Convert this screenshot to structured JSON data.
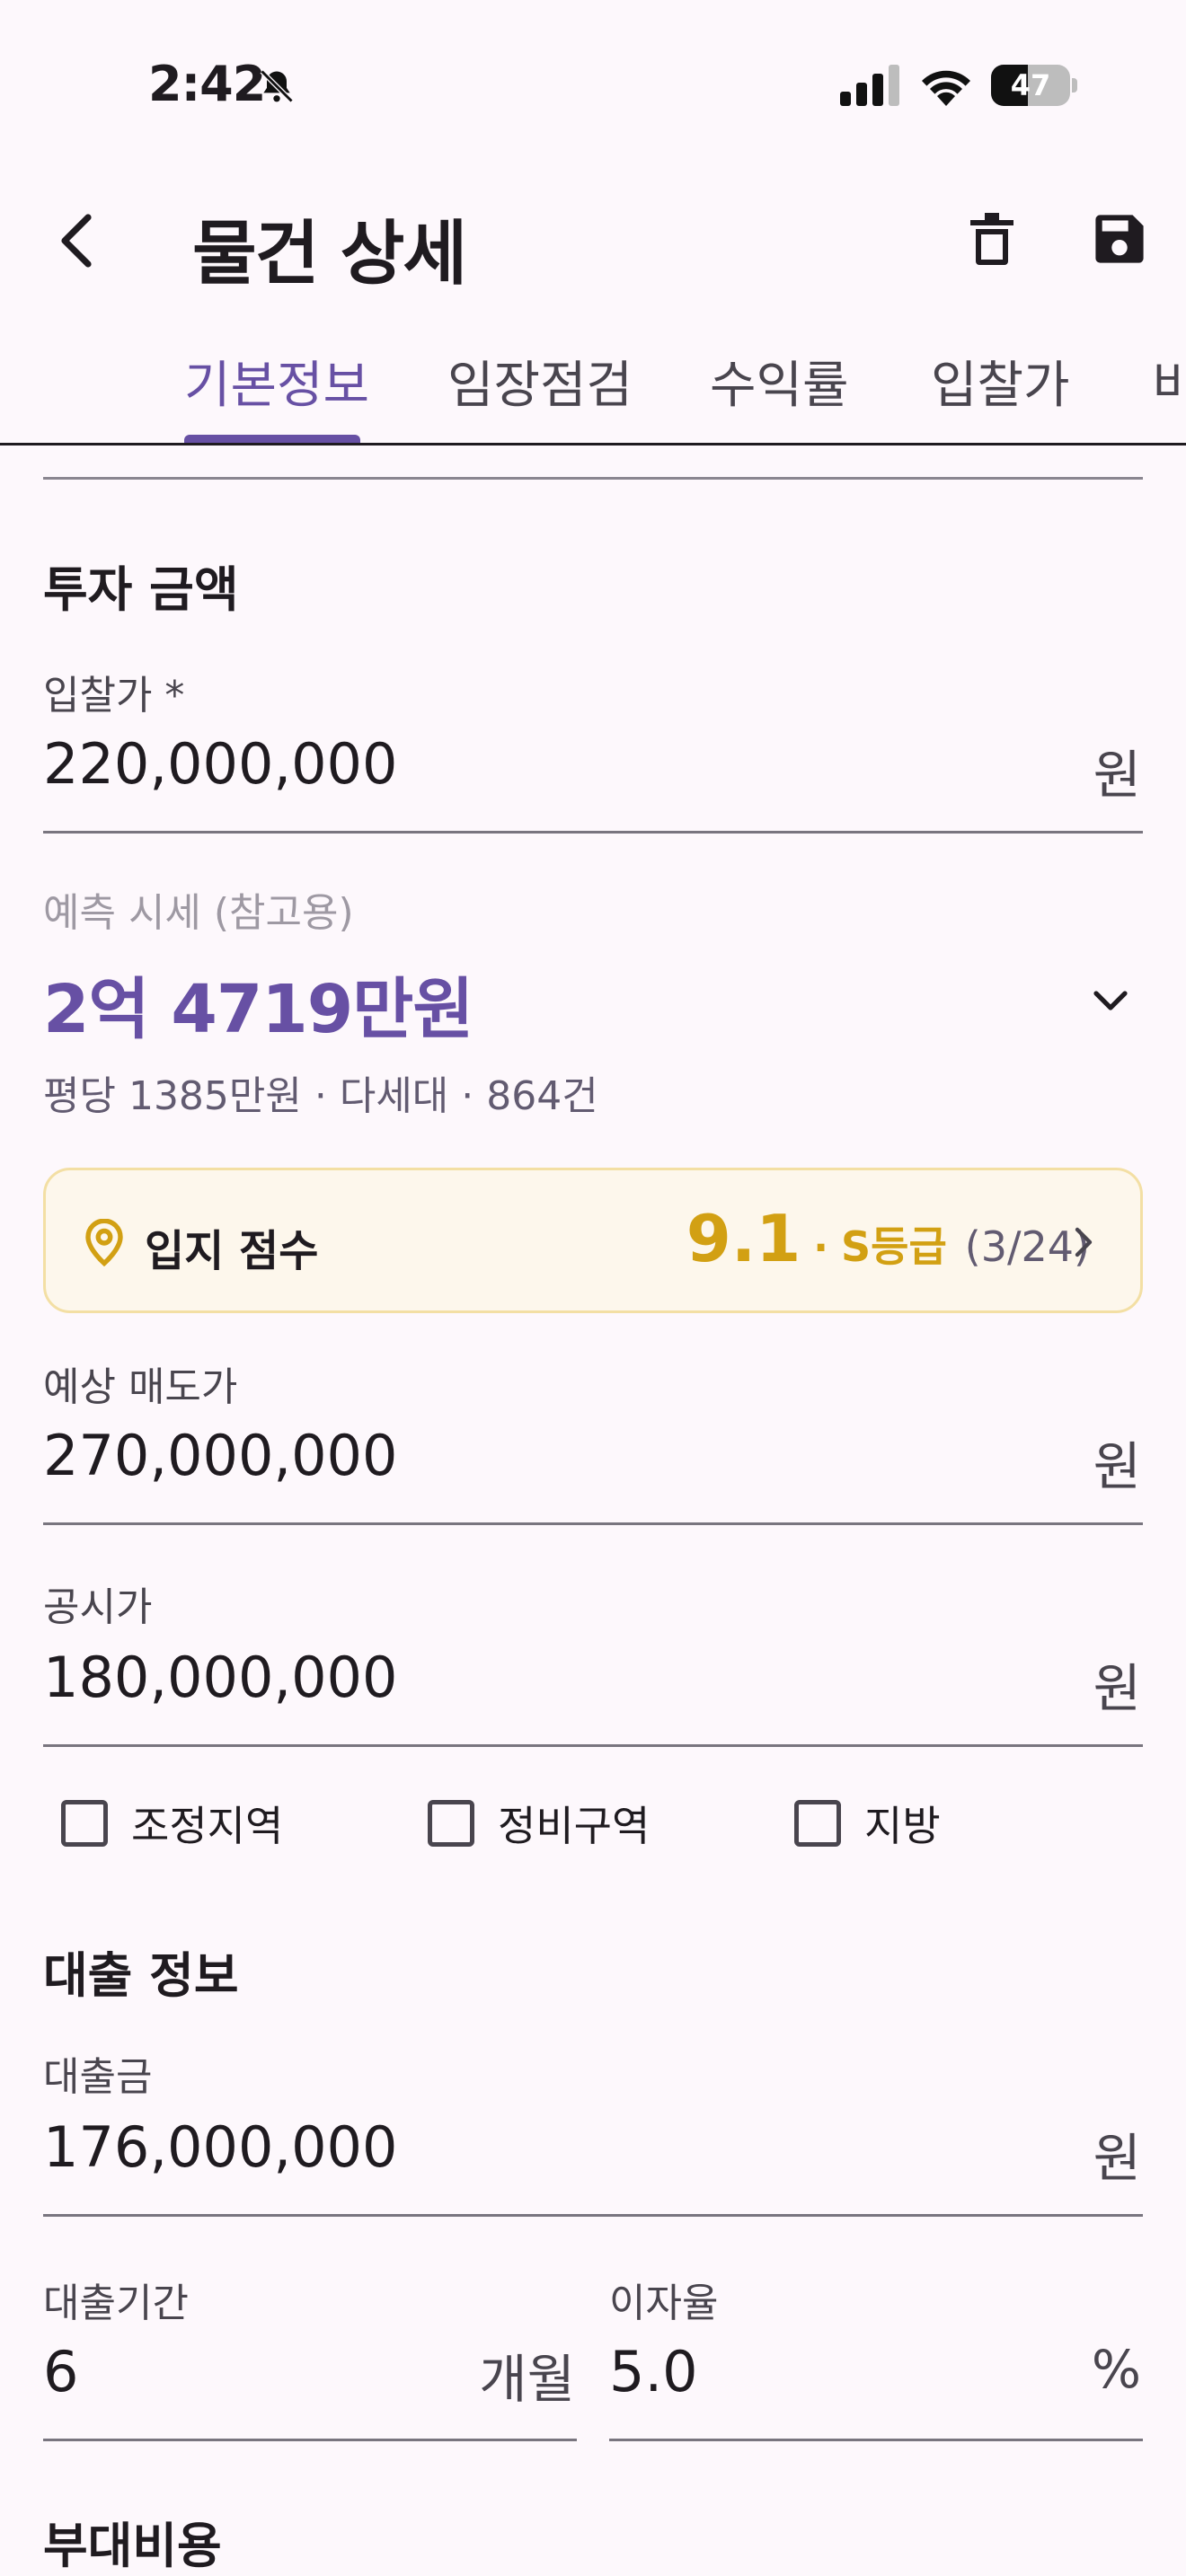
{
  "status_bar": {
    "time": "2:42",
    "battery_level": 47,
    "battery_text": "47"
  },
  "header": {
    "title": "물건 상세",
    "back_icon": "chevron-left-icon",
    "delete_icon": "trash-icon",
    "save_icon": "floppy-disk-icon"
  },
  "tabs": {
    "items": [
      "기본정보",
      "임장점검",
      "수익률",
      "입찰가",
      "비"
    ],
    "active_index": 0
  },
  "invest": {
    "section_title": "투자 금액",
    "bid_price": {
      "label": "입찰가 *",
      "value": "220,000,000",
      "unit": "원"
    },
    "forecast": {
      "label": "예측 시세 (참고용)",
      "value": "2억 4719만원",
      "detail": "평당 1385만원 · 다세대 · 864건"
    },
    "location_score": {
      "label": "입지 점수",
      "score": "9.1",
      "separator": "·",
      "grade": "S등급",
      "rank": "(3/24)"
    },
    "expected_sale": {
      "label": "예상 매도가",
      "value": "270,000,000",
      "unit": "원"
    },
    "official_price": {
      "label": "공시가",
      "value": "180,000,000",
      "unit": "원"
    },
    "checkboxes": [
      {
        "label": "조정지역",
        "checked": false
      },
      {
        "label": "정비구역",
        "checked": false
      },
      {
        "label": "지방",
        "checked": false
      }
    ]
  },
  "loan": {
    "section_title": "대출 정보",
    "amount": {
      "label": "대출금",
      "value": "176,000,000",
      "unit": "원"
    },
    "period": {
      "label": "대출기간",
      "value": "6",
      "unit": "개월"
    },
    "rate": {
      "label": "이자율",
      "value": "5.0",
      "unit": "%"
    }
  },
  "extra": {
    "section_title": "부대비용"
  },
  "colors": {
    "accent": "#6750a4",
    "gold": "#d2a013",
    "card_bg": "#fdf7ec",
    "background": "#fdf8fc"
  }
}
